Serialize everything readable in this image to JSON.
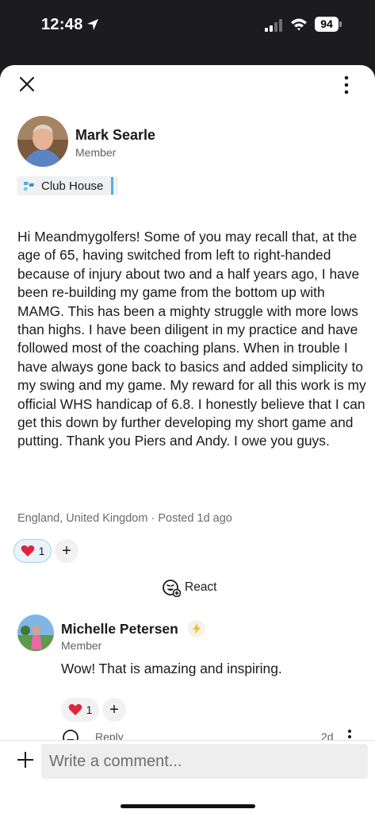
{
  "status_bar": {
    "time": "12:48",
    "battery": "94"
  },
  "post": {
    "author": {
      "name": "Mark Searle",
      "role": "Member"
    },
    "space": "Club House",
    "body": "Hi Meandmygolfers! Some of you may recall that, at the age of 65, having switched from left to right-handed because of injury about two and a half years ago, I have been re-building my game from the bottom up with MAMG. This has been a mighty struggle with more lows than highs. I have been diligent in my practice and have followed most of the coaching plans. When in trouble I have always gone back to basics and added simplicity to my swing and my game. My reward for all this work is my official WHS handicap of 6.8. I honestly believe that I can get this down by further developing my short game and putting. Thank you Piers and Andy. I owe you guys.",
    "location": "England, United Kingdom",
    "posted": "Posted 1d ago",
    "reaction_count": "1",
    "react_label": "React"
  },
  "comment": {
    "author": {
      "name": "Michelle Petersen",
      "role": "Member"
    },
    "text": "Wow! That is amazing and inspiring.",
    "reaction_count": "1",
    "reply_label": "Reply",
    "time": "2d"
  },
  "composer": {
    "placeholder": "Write a comment..."
  },
  "colors": {
    "accent": "#4fb0e0",
    "heart": "#e0243b",
    "badge": "#f0c040"
  }
}
